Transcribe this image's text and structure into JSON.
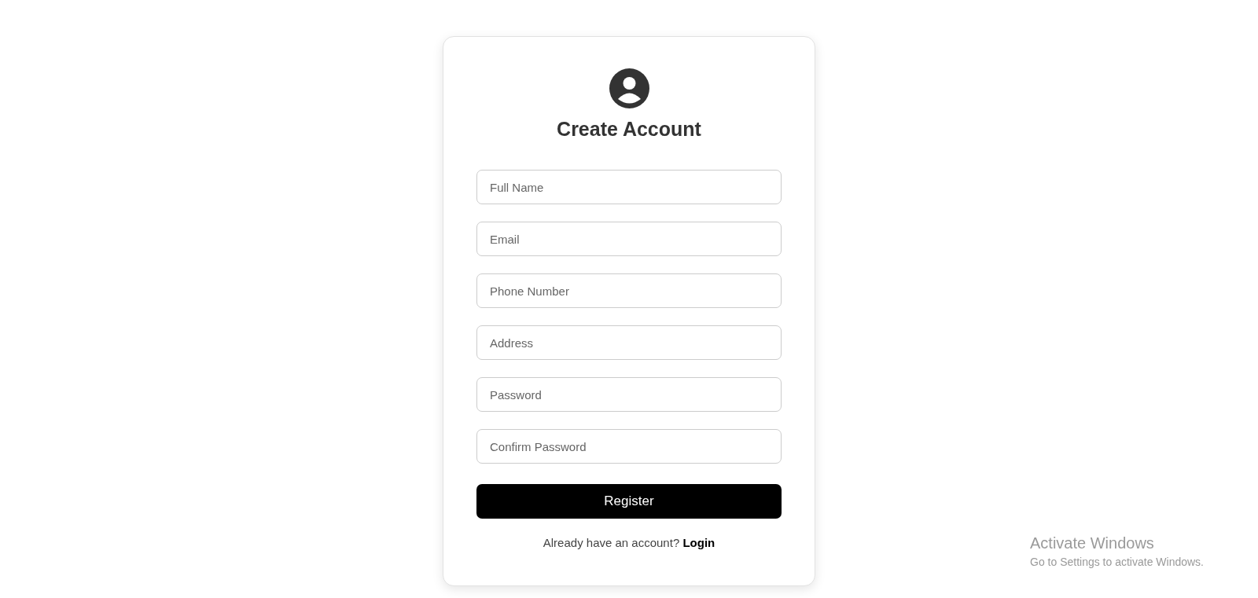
{
  "form": {
    "title": "Create Account",
    "fields": [
      {
        "placeholder": "Full Name"
      },
      {
        "placeholder": "Email"
      },
      {
        "placeholder": "Phone Number"
      },
      {
        "placeholder": "Address"
      },
      {
        "placeholder": "Password"
      },
      {
        "placeholder": "Confirm Password"
      }
    ],
    "submit": "Register",
    "footer": {
      "text": "Already have an account?",
      "link": "Login"
    }
  },
  "os_notice": {
    "title": "Activate Windows",
    "subtitle": "Go to Settings to activate Windows."
  }
}
